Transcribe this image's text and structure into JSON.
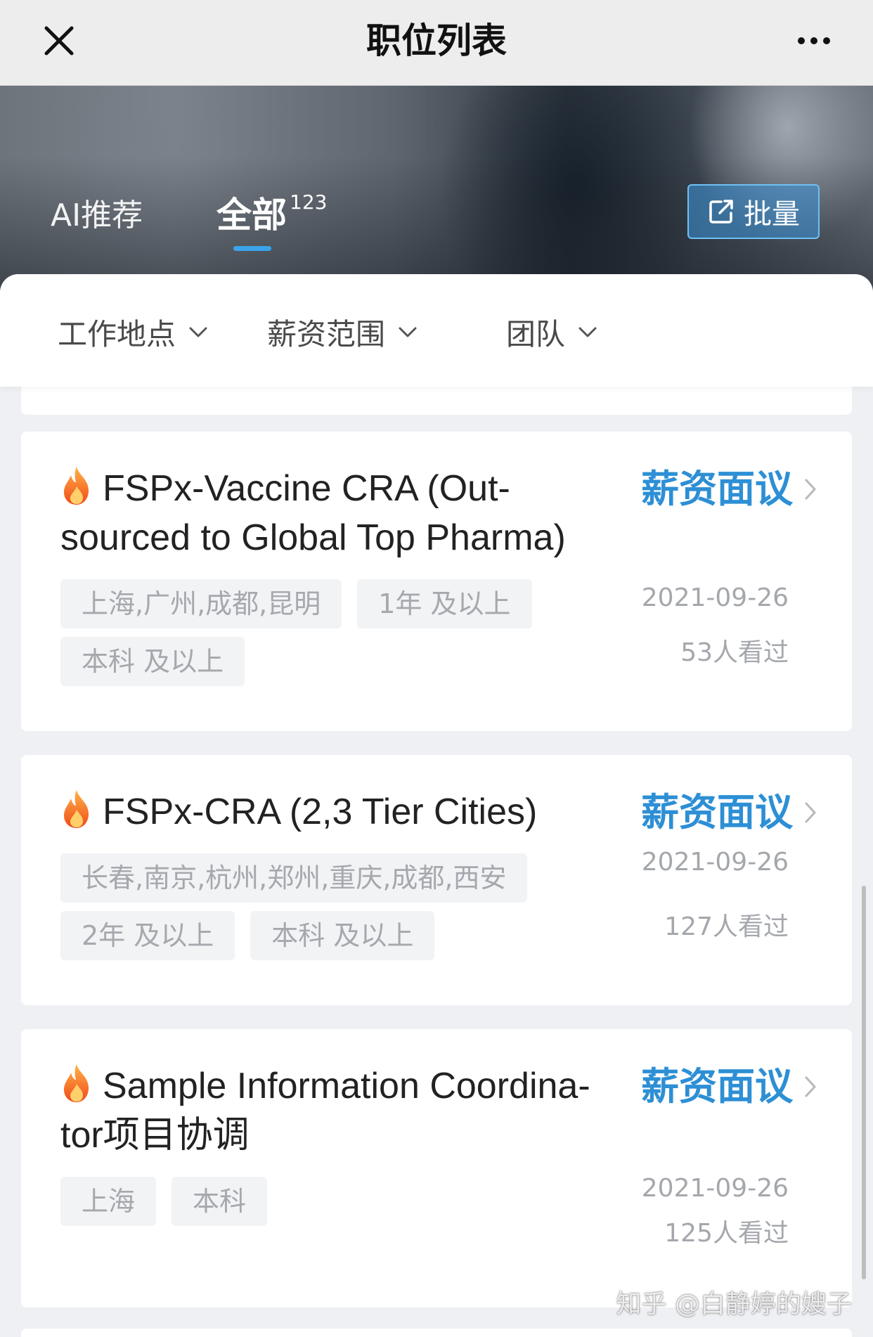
{
  "navbar": {
    "title": "职位列表",
    "close_icon": "close-icon",
    "more_icon": "more-dots-icon"
  },
  "tabs": {
    "ai": "AI推荐",
    "all": "全部",
    "all_count": "123",
    "active": "全部",
    "accent": "#3aa4ea"
  },
  "batch_button": {
    "label": "批量",
    "icon": "share-out-icon"
  },
  "filters": [
    {
      "label": "工作地点"
    },
    {
      "label": "薪资范围"
    },
    {
      "label": "团队"
    }
  ],
  "jobs": [
    {
      "title": "FSPx-Vaccine CRA (Out-sourced to Global Top Pharma)",
      "salary": "薪资面议",
      "tags": [
        "上海,广州,成都,昆明",
        "1年 及以上",
        "本科 及以上"
      ],
      "date": "2021-09-26",
      "views": "53人看过"
    },
    {
      "title": "FSPx-CRA (2,3 Tier Cities)",
      "salary": "薪资面议",
      "tags": [
        "长春,南京,杭州,郑州,重庆,成都,西安",
        "2年 及以上",
        "本科 及以上"
      ],
      "date": "2021-09-26",
      "views": "127人看过"
    },
    {
      "title": "Sample Information Coordina-tor项目协调",
      "salary": "薪资面议",
      "tags": [
        "上海",
        "本科"
      ],
      "date": "2021-09-26",
      "views": "125人看过"
    }
  ],
  "watermark": "知乎 @白静婷的嫂子",
  "colors": {
    "salary": "#2d8fd5",
    "tag_bg": "#f2f3f5",
    "tag_text": "#a5a8ad"
  }
}
